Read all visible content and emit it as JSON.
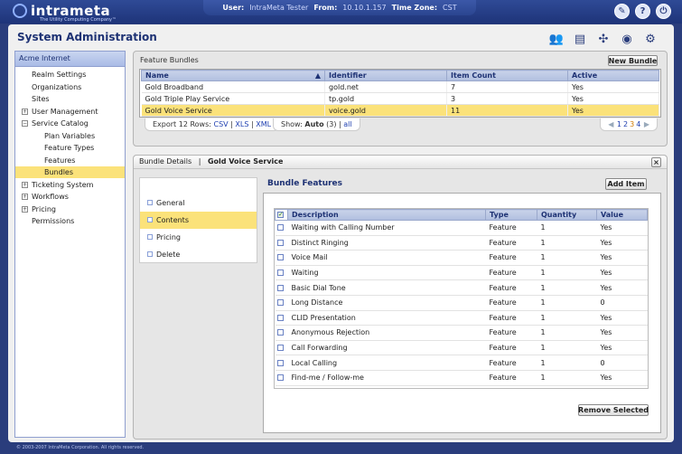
{
  "app": {
    "logo_name": "intrameta",
    "logo_tagline": "The Utility Computing Company™"
  },
  "session": {
    "user_label": "User:",
    "user": "IntraMeta Tester",
    "from_label": "From:",
    "from": "10.10.1.157",
    "tz_label": "Time Zone:",
    "tz": "CST"
  },
  "page_title": "System Administration",
  "sidebar": {
    "header": "Acme Internet",
    "items": [
      {
        "label": "Realm Settings",
        "level": 1
      },
      {
        "label": "Organizations",
        "level": 1
      },
      {
        "label": "Sites",
        "level": 1
      },
      {
        "label": "User Management",
        "level": 0,
        "toggle": "+"
      },
      {
        "label": "Service Catalog",
        "level": 0,
        "toggle": "−"
      },
      {
        "label": "Plan Variables",
        "level": 2
      },
      {
        "label": "Feature Types",
        "level": 2
      },
      {
        "label": "Features",
        "level": 2
      },
      {
        "label": "Bundles",
        "level": 2,
        "selected": true
      },
      {
        "label": "Ticketing System",
        "level": 0,
        "toggle": "+"
      },
      {
        "label": "Workflows",
        "level": 0,
        "toggle": "+"
      },
      {
        "label": "Pricing",
        "level": 0,
        "toggle": "+"
      },
      {
        "label": "Permissions",
        "level": 1
      }
    ]
  },
  "feature_bundles": {
    "title": "Feature Bundles",
    "new_button": "New Bundle",
    "columns": [
      "Name",
      "Identifier",
      "Item Count",
      "Active"
    ],
    "rows": [
      [
        "Gold Broadband",
        "gold.net",
        "7",
        "Yes"
      ],
      [
        "Gold Triple Play Service",
        "tp.gold",
        "3",
        "Yes"
      ],
      [
        "Gold Voice Service",
        "voice.gold",
        "11",
        "Yes"
      ]
    ],
    "selected_row": 2,
    "export_label": "Export 12 Rows:",
    "export_csv": "CSV",
    "export_xls": "XLS",
    "export_xml": "XML",
    "show_label": "Show:",
    "show_auto": "Auto",
    "show_count": "(3)",
    "show_all": "all",
    "pages": [
      "1",
      "2",
      "3",
      "4"
    ],
    "current_page": "3"
  },
  "details": {
    "crumb1": "Bundle Details",
    "sep": "|",
    "crumb2": "Gold Voice Service",
    "close": "×",
    "menu": [
      "General",
      "Contents",
      "Pricing",
      "Delete"
    ],
    "menu_selected": 1
  },
  "bundle_features": {
    "title": "Bundle Features",
    "add_button": "Add Item",
    "remove_button": "Remove Selected",
    "columns": [
      "Description",
      "Type",
      "Quantity",
      "Value"
    ],
    "rows": [
      [
        "Waiting with Calling Number",
        "Feature",
        "1",
        "Yes"
      ],
      [
        "Distinct Ringing",
        "Feature",
        "1",
        "Yes"
      ],
      [
        "Voice Mail",
        "Feature",
        "1",
        "Yes"
      ],
      [
        "Waiting",
        "Feature",
        "1",
        "Yes"
      ],
      [
        "Basic Dial Tone",
        "Feature",
        "1",
        "Yes"
      ],
      [
        "Long Distance",
        "Feature",
        "1",
        "0"
      ],
      [
        "CLID Presentation",
        "Feature",
        "1",
        "Yes"
      ],
      [
        "Anonymous Rejection",
        "Feature",
        "1",
        "Yes"
      ],
      [
        "Call Forwarding",
        "Feature",
        "1",
        "Yes"
      ],
      [
        "Local Calling",
        "Feature",
        "1",
        "0"
      ],
      [
        "Find-me / Follow-me",
        "Feature",
        "1",
        "Yes"
      ]
    ]
  },
  "footer": "© 2003-2007 IntraMeta Corporation.  All rights reserved."
}
